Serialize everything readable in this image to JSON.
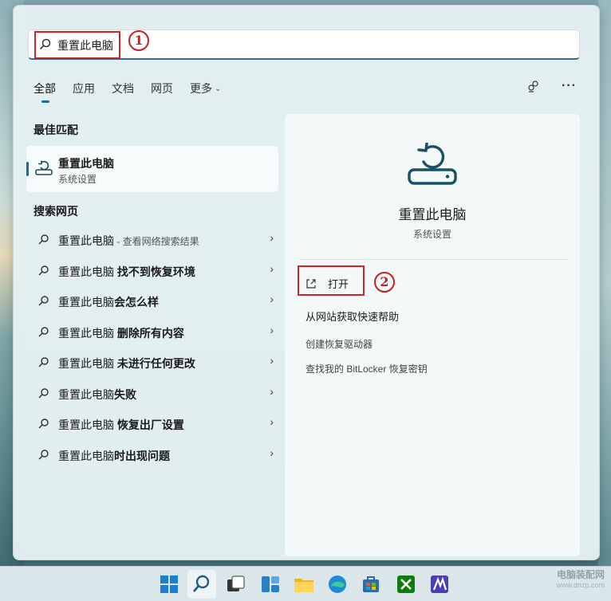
{
  "search": {
    "query": "重置此电脑"
  },
  "annotations": {
    "step1": "1",
    "step2": "2"
  },
  "tabs": [
    {
      "label": "全部"
    },
    {
      "label": "应用"
    },
    {
      "label": "文档"
    },
    {
      "label": "网页"
    },
    {
      "label": "更多"
    }
  ],
  "best_match": {
    "section_title": "最佳匹配",
    "title": "重置此电脑",
    "subtitle": "系统设置"
  },
  "web_search": {
    "section_title": "搜索网页",
    "items": [
      {
        "prefix": "重置此电脑",
        "suffix_plain": " - 查看网络搜索结果",
        "bold": ""
      },
      {
        "prefix": "重置此电脑",
        "suffix_plain": "",
        "bold": " 找不到恢复环境"
      },
      {
        "prefix": "重置此电脑",
        "suffix_plain": "",
        "bold": "会怎么样"
      },
      {
        "prefix": "重置此电脑",
        "suffix_plain": "",
        "bold": " 删除所有内容"
      },
      {
        "prefix": "重置此电脑",
        "suffix_plain": "",
        "bold": " 未进行任何更改"
      },
      {
        "prefix": "重置此电脑",
        "suffix_plain": "",
        "bold": "失败"
      },
      {
        "prefix": "重置此电脑",
        "suffix_plain": "",
        "bold": " 恢复出厂设置"
      },
      {
        "prefix": "重置此电脑",
        "suffix_plain": "",
        "bold": "时出现问题"
      }
    ]
  },
  "detail": {
    "title": "重置此电脑",
    "subtitle": "系统设置",
    "open_label": "打开",
    "actions": [
      "从网站获取快速帮助",
      "创建恢复驱动器",
      "查找我的 BitLocker 恢复密钥"
    ]
  },
  "watermark": {
    "line1": "电脑装配网",
    "line2": "www.dnzp.com"
  },
  "colors": {
    "accent": "#1a6aa0",
    "annotation_red": "#d32222"
  }
}
